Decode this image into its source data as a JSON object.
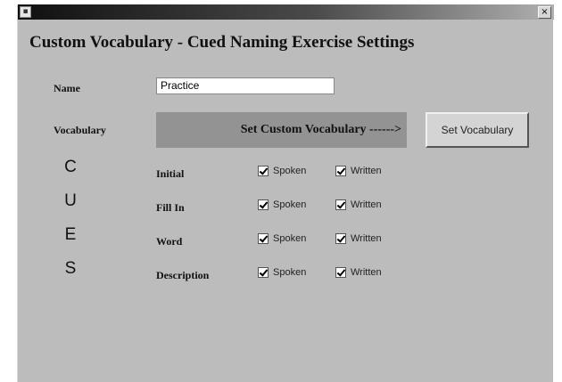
{
  "window": {
    "close_glyph": "×",
    "icon": "app-icon"
  },
  "heading": "Custom Vocabulary - Cued Naming Exercise Settings",
  "name_label": "Name",
  "name_value": "Practice",
  "vocabulary_label": "Vocabulary",
  "vocab_bar_text": "Set Custom Vocabulary ------>",
  "set_vocabulary_button": "Set Vocabulary",
  "cues_letters": [
    "C",
    "U",
    "E",
    "S"
  ],
  "cue_rows": [
    {
      "label": "Initial",
      "spoken_label": "Spoken",
      "spoken": true,
      "written_label": "Written",
      "written": true
    },
    {
      "label": "Fill In",
      "spoken_label": "Spoken",
      "spoken": true,
      "written_label": "Written",
      "written": true
    },
    {
      "label": "Word",
      "spoken_label": "Spoken",
      "spoken": true,
      "written_label": "Written",
      "written": true
    },
    {
      "label": "Description",
      "spoken_label": "Spoken",
      "spoken": true,
      "written_label": "Written",
      "written": true
    }
  ],
  "colors": {
    "window_bg": "#bcbcbc",
    "vocab_bar_bg": "#939393"
  }
}
